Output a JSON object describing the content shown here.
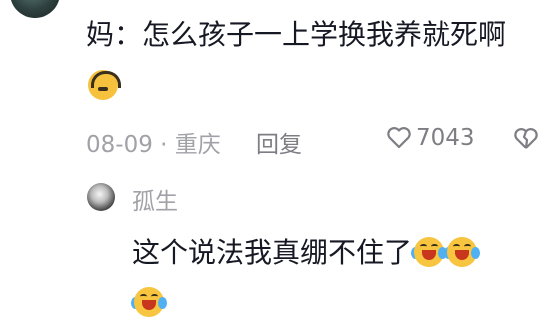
{
  "comment": {
    "text": "妈：怎么孩子一上学换我养就死啊",
    "emoji": "headphones-face-emoji",
    "date_location": "08-09 · 重庆",
    "reply_label": "回复",
    "like_count": "7043",
    "like_icon": "heart-outline-icon",
    "dislike_icon": "broken-heart-outline-icon"
  },
  "reply": {
    "author": "孤生",
    "text": "这个说法我真绷不住了",
    "emojis": [
      "laughing-crying-emoji",
      "laughing-crying-emoji",
      "laughing-crying-emoji"
    ]
  },
  "colors": {
    "text_primary": "#161823",
    "text_secondary": "#a1a1a8",
    "emoji_yellow": "#f6c23e"
  }
}
